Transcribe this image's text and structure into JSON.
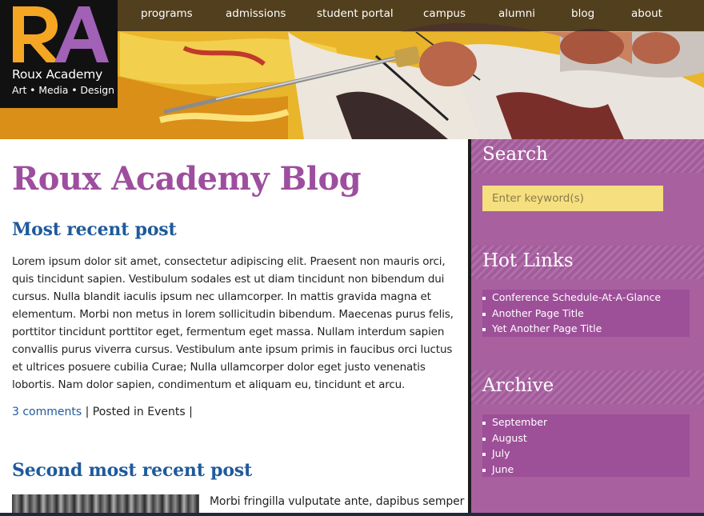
{
  "brand": {
    "logo_letters": "RA",
    "name": "Roux Academy",
    "tagline": "Art • Media • Design",
    "colors": {
      "logo_r": "#f5a623",
      "logo_a": "#a161b6",
      "accent": "#9e4e9e",
      "link": "#1f5a9c"
    }
  },
  "nav": {
    "items": [
      {
        "label": "programs"
      },
      {
        "label": "admissions"
      },
      {
        "label": "student portal"
      },
      {
        "label": "campus"
      },
      {
        "label": "alumni"
      },
      {
        "label": "blog"
      },
      {
        "label": "about"
      }
    ]
  },
  "main": {
    "page_title": "Roux Academy Blog",
    "posts": [
      {
        "title": "Most recent post",
        "body": "Lorem ipsum dolor sit amet, consectetur adipiscing elit. Praesent non mauris orci, quis tincidunt sapien. Vestibulum sodales est ut diam tincidunt non bibendum dui cursus. Nulla blandit iaculis ipsum nec ullamcorper. In mattis gravida magna et elementum. Morbi non metus in lorem sollicitudin bibendum. Maecenas purus felis, porttitor tincidunt porttitor eget, fermentum eget massa. Nullam interdum sapien convallis purus viverra cursus. Vestibulum ante ipsum primis in faucibus orci luctus et ultrices posuere cubilia Curae; Nulla ullamcorper dolor eget justo venenatis lobortis. Nam dolor sapien, condimentum et aliquam eu, tincidunt et arcu.",
        "comments_link": "3 comments",
        "meta_text": "| Posted in Events |"
      },
      {
        "title": "Second most recent post",
        "excerpt": "Morbi fringilla vulputate ante, dapibus semper"
      }
    ]
  },
  "sidebar": {
    "search": {
      "heading": "Search",
      "placeholder": "Enter keyword(s)"
    },
    "hot_links": {
      "heading": "Hot Links",
      "items": [
        {
          "label": "Conference Schedule-At-A-Glance"
        },
        {
          "label": "Another Page Title"
        },
        {
          "label": "Yet Another Page Title"
        }
      ]
    },
    "archive": {
      "heading": "Archive",
      "items": [
        {
          "label": "September"
        },
        {
          "label": "August"
        },
        {
          "label": "July"
        },
        {
          "label": "June"
        }
      ]
    }
  }
}
